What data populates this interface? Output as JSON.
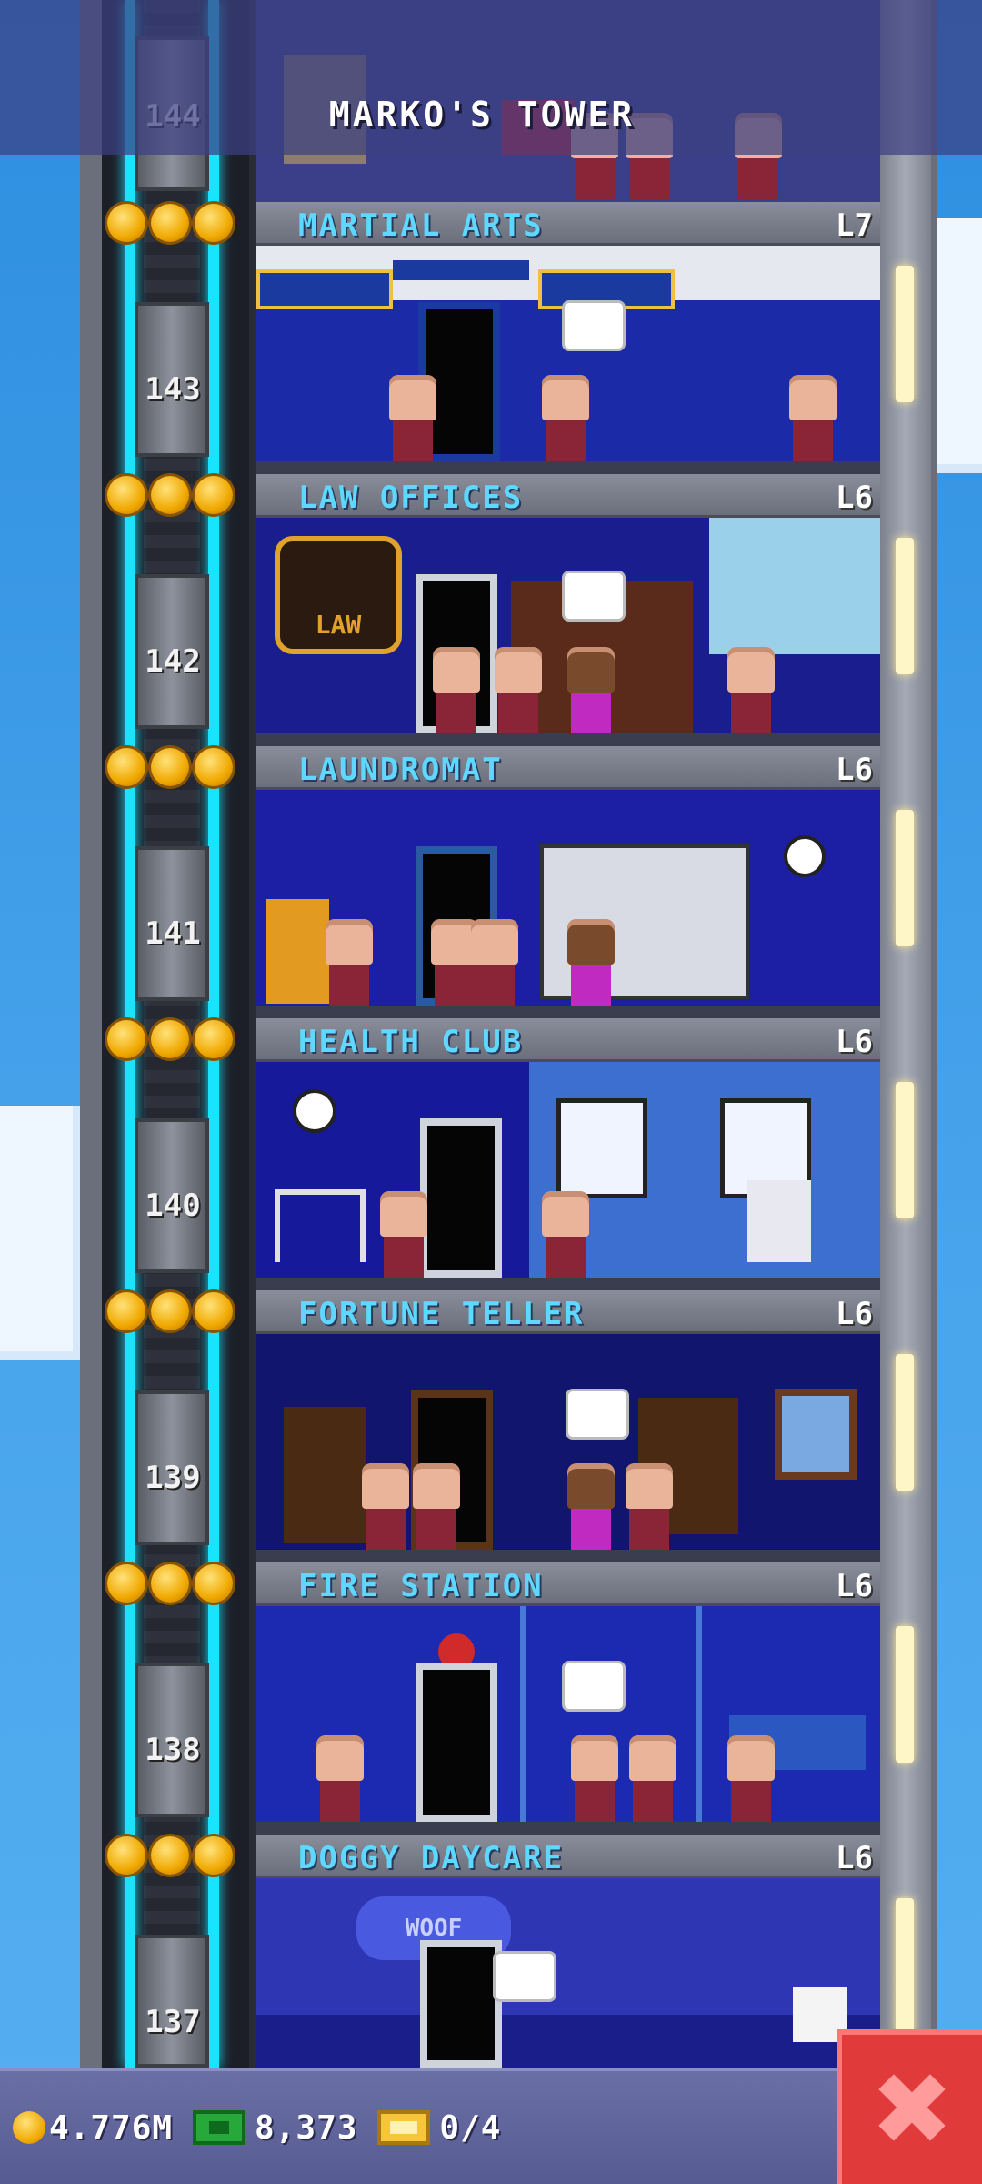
{
  "header": {
    "title": "MARKO'S TOWER"
  },
  "floors": [
    {
      "number": "144",
      "name": "MARTIAL ARTS",
      "level": "L7"
    },
    {
      "number": "143",
      "name": "LAW OFFICES",
      "level": "L6"
    },
    {
      "number": "142",
      "name": "LAUNDROMAT",
      "level": "L6"
    },
    {
      "number": "141",
      "name": "HEALTH CLUB",
      "level": "L6"
    },
    {
      "number": "140",
      "name": "FORTUNE TELLER",
      "level": "L6"
    },
    {
      "number": "139",
      "name": "FIRE STATION",
      "level": "L6"
    },
    {
      "number": "138",
      "name": "DOGGY DAYCARE",
      "level": "L6"
    },
    {
      "number": "137",
      "name": "",
      "level": ""
    }
  ],
  "room_decor": {
    "law_sign": "LAW",
    "woof_sign": "WOOF"
  },
  "bottom_bar": {
    "coins": "4.776M",
    "bux": "8,373",
    "tickets": "0/4"
  },
  "colors": {
    "sky": "#49a5ec",
    "floor_name": "#5fd8ff",
    "close_button": "#e03a3a",
    "cable": "#19e3ff"
  }
}
